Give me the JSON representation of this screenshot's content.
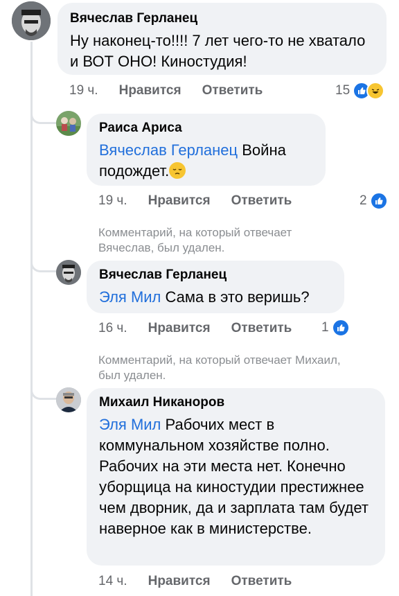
{
  "comments": [
    {
      "author": "Вячеслав Герланец",
      "text": "Ну наконец-то!!!! 7 лет чего-то не хватало и ВОТ ОНО! Киностудия!",
      "time": "19 ч.",
      "like_label": "Нравится",
      "reply_label": "Ответить",
      "reactions": "15",
      "reaction_icons": [
        "like-icon",
        "haha-icon"
      ]
    },
    {
      "author": "Раиса Ариса",
      "mention": "Вячеслав Герланец",
      "text": " Война подождет.",
      "emoji": "pensive-face-icon",
      "time": "19 ч.",
      "like_label": "Нравится",
      "reply_label": "Ответить",
      "reactions": "2",
      "reaction_icons": [
        "like-icon"
      ]
    },
    {
      "deleted_notice": "Комментарий, на который отвечает Вячеслав, был удален."
    },
    {
      "author": "Вячеслав Герланец",
      "mention": "Эля Мил",
      "text": " Сама в это веришь?",
      "time": "16 ч.",
      "like_label": "Нравится",
      "reply_label": "Ответить",
      "reactions": "1",
      "reaction_icons": [
        "like-icon"
      ]
    },
    {
      "deleted_notice": "Комментарий, на который отвечает Михаил, был удален."
    },
    {
      "author": "Михаил Никаноров",
      "mention": "Эля Мил",
      "text": " Рабочих мест в коммунальном хозяйстве полно. Рабочих на эти места нет. Конечно уборщица на киностудии престижнее чем дворник, да и зарплата там будет наверное как в министерстве.",
      "time": "14 ч.",
      "like_label": "Нравится",
      "reply_label": "Ответить"
    }
  ],
  "colors": {
    "bubble": "#f0f2f5",
    "mention": "#216fdb",
    "meta": "#65676b",
    "like": "#1b74e4",
    "haha": "#f7c531"
  }
}
